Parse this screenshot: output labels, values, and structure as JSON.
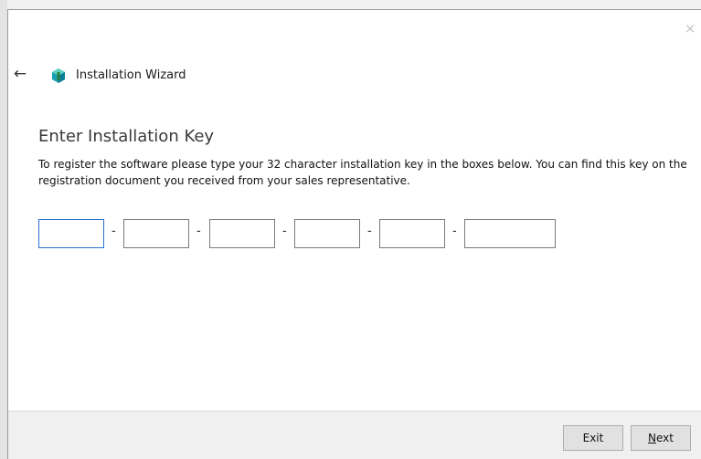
{
  "window": {
    "title": "Installation Wizard",
    "close_glyph": "×",
    "back_glyph": "←",
    "icon": "app-logo-icon",
    "accent_color": "#1aa0b4"
  },
  "page": {
    "heading": "Enter Installation Key",
    "description": "To register the software please type your 32 character installation key in the boxes below. You can find this key on the registration document you received from your sales representative."
  },
  "key_fields": [
    {
      "value": ""
    },
    {
      "value": ""
    },
    {
      "value": ""
    },
    {
      "value": ""
    },
    {
      "value": ""
    },
    {
      "value": ""
    }
  ],
  "separator": "-",
  "footer": {
    "exit_label": "Exit",
    "next_label_first": "N",
    "next_label_rest": "ext"
  },
  "colors": {
    "focus_border": "#2a6fd0"
  }
}
